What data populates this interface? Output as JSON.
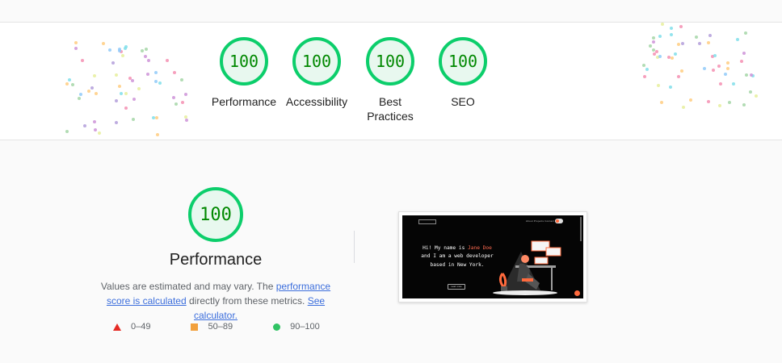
{
  "colors": {
    "pass": "#0cce6b",
    "pass_text": "#008800",
    "fail": "#e52a24",
    "average": "#f2a03c",
    "good": "#30c364",
    "link": "#3c6edc"
  },
  "scores": [
    {
      "value": "100",
      "label": "Performance"
    },
    {
      "value": "100",
      "label": "Accessibility"
    },
    {
      "value": "100",
      "label": "Best Practices"
    },
    {
      "value": "100",
      "label": "SEO"
    }
  ],
  "performance": {
    "score": "100",
    "title": "Performance",
    "desc_prefix": "Values are estimated and may vary. The ",
    "desc_link1": "performance score is calculated",
    "desc_middle": " directly from these metrics. ",
    "desc_link2": "See calculator."
  },
  "legend": [
    {
      "shape": "triangle",
      "range": "0–49"
    },
    {
      "shape": "square",
      "range": "50–89"
    },
    {
      "shape": "circle",
      "range": "90–100"
    }
  ],
  "screenshot": {
    "nav": "About  Projects  Contact",
    "hero_line1": "Hi! My name is ",
    "hero_name": "Jane Doe",
    "hero_line2": " and I am a web developer based in New York.",
    "button": "Learn more"
  }
}
